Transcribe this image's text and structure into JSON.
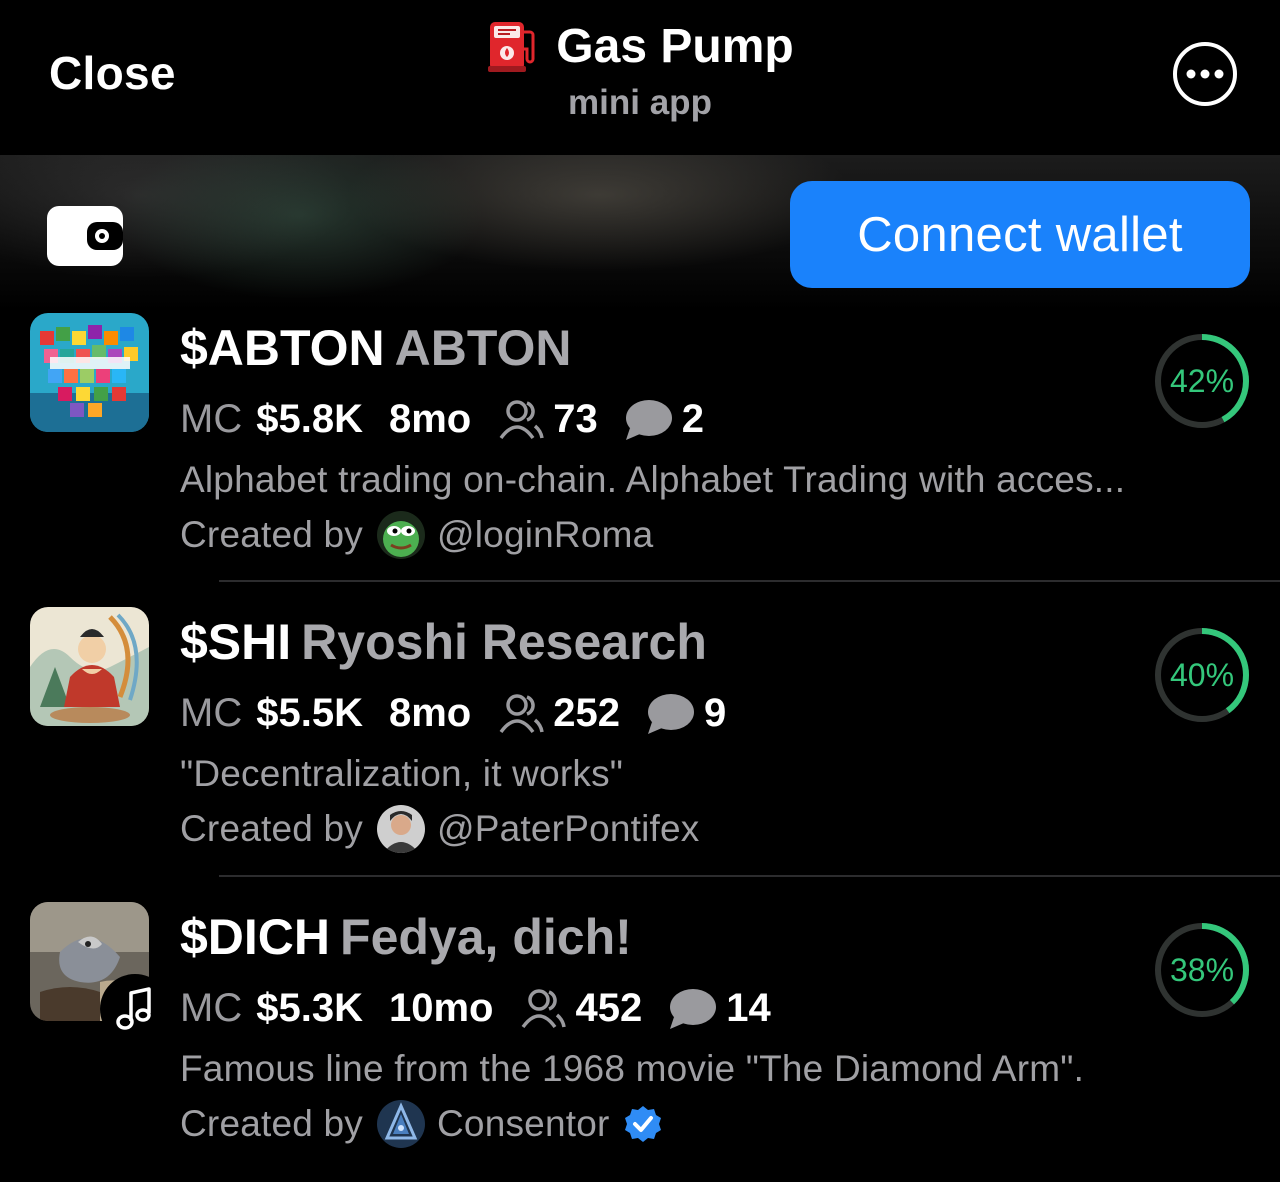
{
  "header": {
    "close_label": "Close",
    "app_title": "Gas Pump",
    "app_subtitle": "mini app",
    "more_icon": "ellipsis-circle-icon",
    "app_icon": "fuel-pump-icon"
  },
  "wallet_bar": {
    "wallet_icon": "wallet-icon",
    "connect_label": "Connect wallet",
    "accent_color": "#1a82fb"
  },
  "tokens": [
    {
      "ticker": "$ABTON",
      "name": "ABTON",
      "mc_label": "MC",
      "market_cap": "$5.8K",
      "age": "8mo",
      "holders": "73",
      "comments": "2",
      "description": "Alphabet trading on-chain. Alphabet Trading with acces...",
      "created_by_label": "Created by",
      "creator": "@loginRoma",
      "creator_verified": false,
      "progress_percent": 42,
      "progress_label": "42%"
    },
    {
      "ticker": "$SHI",
      "name": "Ryoshi Research",
      "mc_label": "MC",
      "market_cap": "$5.5K",
      "age": "8mo",
      "holders": "252",
      "comments": "9",
      "description": "\"Decentralization, it works\"",
      "created_by_label": "Created by",
      "creator": "@PaterPontifex",
      "creator_verified": false,
      "progress_percent": 40,
      "progress_label": "40%"
    },
    {
      "ticker": "$DICH",
      "name": "Fedya, dich!",
      "mc_label": "MC",
      "market_cap": "$5.3K",
      "age": "10mo",
      "holders": "452",
      "comments": "14",
      "description": "Famous line from the 1968 movie \"The Diamond Arm\".",
      "created_by_label": "Created by",
      "creator": "Consentor",
      "creator_verified": true,
      "progress_percent": 38,
      "progress_label": "38%",
      "badge_icon": "music-note-icon"
    }
  ],
  "colors": {
    "progress_green": "#34c77b",
    "muted_text": "#a0a0a4",
    "verified_blue": "#2f8cf5"
  }
}
